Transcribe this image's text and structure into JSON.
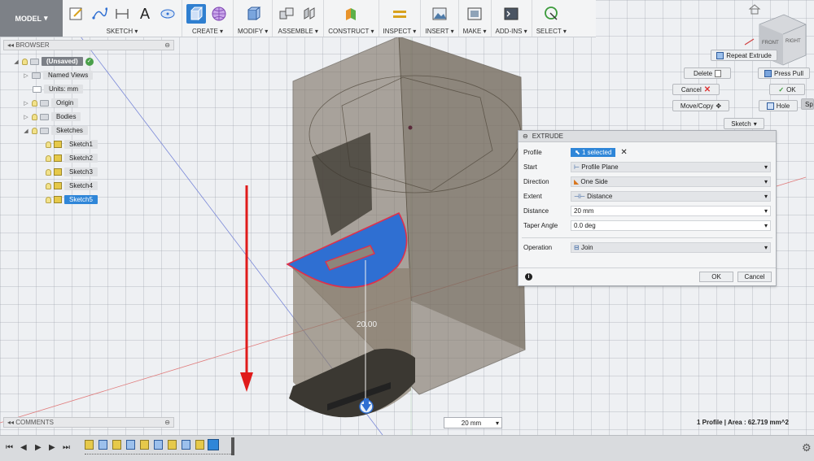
{
  "toolbar": {
    "model": "MODEL",
    "groups": [
      {
        "label": "SKETCH"
      },
      {
        "label": "CREATE"
      },
      {
        "label": "MODIFY"
      },
      {
        "label": "ASSEMBLE"
      },
      {
        "label": "CONSTRUCT"
      },
      {
        "label": "INSPECT"
      },
      {
        "label": "INSERT"
      },
      {
        "label": "MAKE"
      },
      {
        "label": "ADD-INS"
      },
      {
        "label": "SELECT"
      }
    ]
  },
  "browser": {
    "title": "BROWSER",
    "root": "(Unsaved)",
    "items": [
      "Named Views",
      "Units: mm",
      "Origin",
      "Bodies",
      "Sketches"
    ],
    "sketches": [
      "Sketch1",
      "Sketch2",
      "Sketch3",
      "Sketch4",
      "Sketch5"
    ]
  },
  "quick": {
    "repeat_extrude": "Repeat Extrude",
    "delete": "Delete",
    "press_pull": "Press Pull",
    "cancel": "Cancel",
    "ok": "OK",
    "move_copy": "Move/Copy",
    "hole": "Hole",
    "sketch": "Sketch",
    "cut_off": "Sp"
  },
  "extrude": {
    "title": "EXTRUDE",
    "profile_label": "Profile",
    "profile_value": "1 selected",
    "start_label": "Start",
    "start_value": "Profile Plane",
    "direction_label": "Direction",
    "direction_value": "One Side",
    "extent_label": "Extent",
    "extent_value": "Distance",
    "distance_label": "Distance",
    "distance_value": "20 mm",
    "taper_label": "Taper Angle",
    "taper_value": "0.0 deg",
    "operation_label": "Operation",
    "operation_value": "Join",
    "ok": "OK",
    "cancel": "Cancel"
  },
  "viewport": {
    "dimension_label": "20.00",
    "distance_box": "20 mm",
    "status": "1 Profile | Area : 62.719 mm^2",
    "viewcube_front": "FRONT",
    "viewcube_right": "RIGHT"
  },
  "comments": "COMMENTS",
  "colors": {
    "accent": "#2f86d8",
    "profile_blue": "#2f6fd2",
    "body": "#7d7364",
    "arrow_red": "#e01b1b"
  }
}
